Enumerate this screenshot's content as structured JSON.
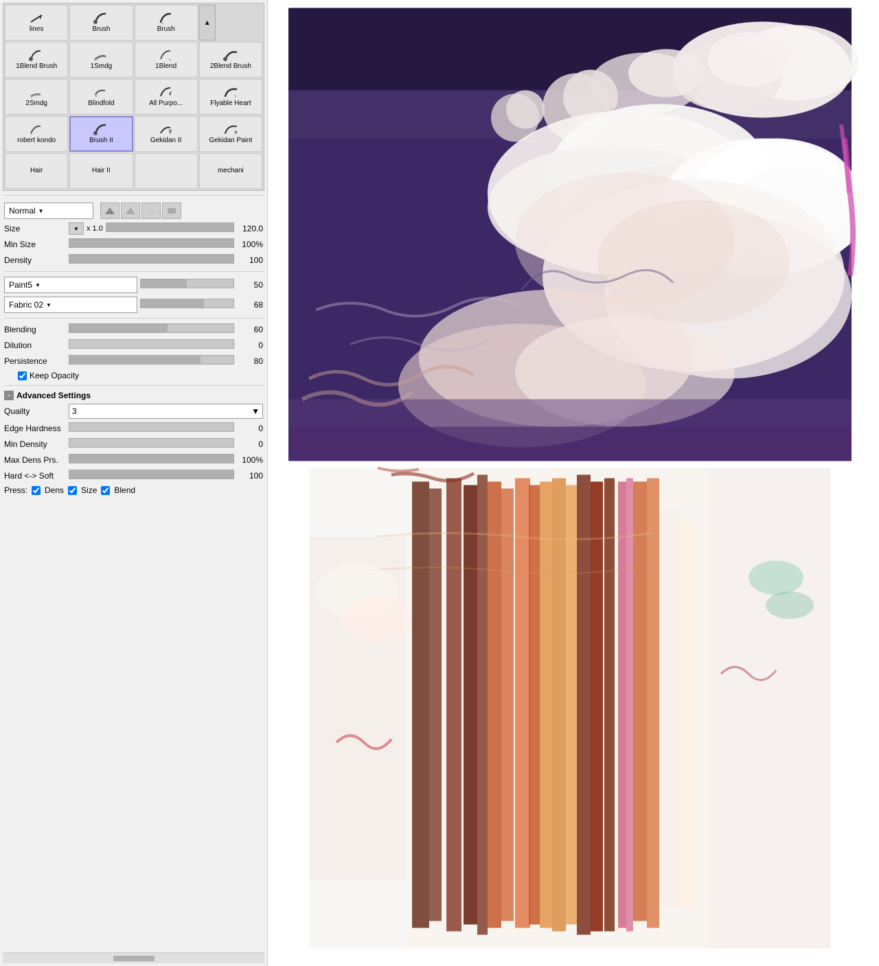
{
  "brushGrid": {
    "cells": [
      {
        "name": "lines",
        "icon": "pen",
        "selected": false
      },
      {
        "name": "Brush",
        "icon": "brush",
        "selected": false
      },
      {
        "name": "Brush",
        "icon": "brush-drop",
        "selected": false
      },
      {
        "name": "",
        "icon": "scroll-up",
        "selected": false,
        "isScroll": true
      },
      {
        "name": "1Blend Brush",
        "icon": "brush",
        "selected": false
      },
      {
        "name": "1Smdg",
        "icon": "smudge",
        "selected": false
      },
      {
        "name": "1Blend",
        "icon": "blend-drop",
        "selected": false
      },
      {
        "name": "2Blend Brush",
        "icon": "brush2",
        "selected": false
      },
      {
        "name": "2Smdg",
        "icon": "smudge2",
        "selected": false
      },
      {
        "name": "Blindfold",
        "icon": "blindfold",
        "selected": false
      },
      {
        "name": "All Purpo...",
        "icon": "allpurpose",
        "selected": false
      },
      {
        "name": "Flyable Heart",
        "icon": "flyable",
        "selected": false
      },
      {
        "name": "robert kondo",
        "icon": "robertkondo",
        "selected": false
      },
      {
        "name": "Brush II",
        "icon": "brushii",
        "selected": true
      },
      {
        "name": "Gekidan II",
        "icon": "gekidan2",
        "selected": false
      },
      {
        "name": "Gekidan Paint",
        "icon": "gekidanpaint",
        "selected": false
      },
      {
        "name": "Hair",
        "icon": "hair",
        "selected": false
      },
      {
        "name": "Hair II",
        "icon": "hairii",
        "selected": false
      },
      {
        "name": "",
        "icon": "blank",
        "selected": false
      },
      {
        "name": "mechani",
        "icon": "mechani",
        "selected": false,
        "isScroll": false
      }
    ]
  },
  "controls": {
    "blendMode": {
      "label": "Normal",
      "arrow": "▼"
    },
    "brushShapes": [
      "▲",
      "▲",
      "▲",
      "■"
    ],
    "size": {
      "label": "Size",
      "multiplier": "x 1.0",
      "value": "120.0",
      "percent": 100
    },
    "minSize": {
      "label": "Min Size",
      "value": "100%",
      "percent": 100
    },
    "density": {
      "label": "Density",
      "value": "100",
      "percent": 100
    },
    "texture1": {
      "name": "Paint5",
      "value": "50",
      "percent": 50
    },
    "texture2": {
      "name": "Fabric 02",
      "value": "68",
      "percent": 68
    },
    "blending": {
      "label": "Blending",
      "value": "60",
      "percent": 60
    },
    "dilution": {
      "label": "Dilution",
      "value": "0",
      "percent": 0
    },
    "persistence": {
      "label": "Persistence",
      "value": "80",
      "percent": 80
    },
    "keepOpacity": {
      "label": "Keep Opacity",
      "checked": true
    },
    "advancedSettings": {
      "label": "Advanced Settings",
      "expanded": true
    },
    "quality": {
      "label": "Quailty",
      "value": "3",
      "arrow": "▼"
    },
    "edgeHardness": {
      "label": "Edge Hardness",
      "value": "0",
      "percent": 0
    },
    "minDensity": {
      "label": "Min Density",
      "value": "0",
      "percent": 0
    },
    "maxDensPrs": {
      "label": "Max Dens Prs.",
      "value": "100%",
      "percent": 100
    },
    "hardSoft": {
      "label": "Hard <-> Soft",
      "value": "100",
      "percent": 100
    },
    "press": {
      "label": "Press:",
      "dens": {
        "label": "Dens",
        "checked": true
      },
      "size": {
        "label": "Size",
        "checked": true
      },
      "blend": {
        "label": "Blend",
        "checked": true
      }
    }
  }
}
